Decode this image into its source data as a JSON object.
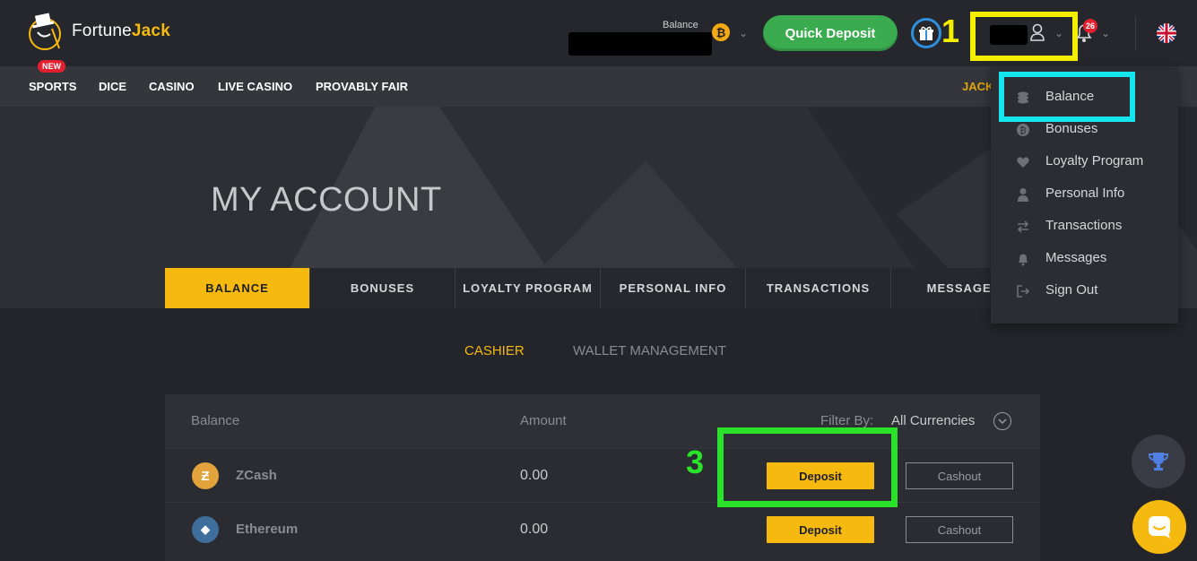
{
  "brand": {
    "name_part1": "Fortune",
    "name_part2": "Jack"
  },
  "header": {
    "balance_label": "Balance",
    "btc_symbol": "₿",
    "quick_deposit": "Quick Deposit",
    "notification_count": "26",
    "annotation_1": "1"
  },
  "nav": {
    "new_badge": "NEW",
    "items": [
      "SPORTS",
      "DICE",
      "CASINO",
      "LIVE CASINO",
      "PROVABLY FAIR"
    ],
    "jackpot_partial": "JACK"
  },
  "page": {
    "title": "MY ACCOUNT"
  },
  "tabs": [
    "BALANCE",
    "BONUSES",
    "LOYALTY PROGRAM",
    "PERSONAL INFO",
    "TRANSACTIONS",
    "MESSAGES"
  ],
  "subtabs": {
    "cashier": "CASHIER",
    "wallet": "WALLET MANAGEMENT"
  },
  "table": {
    "col_balance": "Balance",
    "col_amount": "Amount",
    "filter_label": "Filter By:",
    "filter_value": "All Currencies",
    "rows": [
      {
        "coin": "ZCash",
        "amount": "0.00",
        "deposit": "Deposit",
        "cashout": "Cashout",
        "color": "#e2a23c",
        "glyph": "Ƶ"
      },
      {
        "coin": "Ethereum",
        "amount": "0.00",
        "deposit": "Deposit",
        "cashout": "Cashout",
        "color": "#3f6e9c",
        "glyph": "◆"
      }
    ],
    "annotation_3": "3"
  },
  "dropdown": {
    "items": [
      {
        "label": "Balance",
        "icon": "coins-icon"
      },
      {
        "label": "Bonuses",
        "icon": "bitcoin-icon"
      },
      {
        "label": "Loyalty Program",
        "icon": "heart-icon"
      },
      {
        "label": "Personal Info",
        "icon": "person-icon"
      },
      {
        "label": "Transactions",
        "icon": "arrows-icon"
      },
      {
        "label": "Messages",
        "icon": "bell-icon"
      },
      {
        "label": "Sign Out",
        "icon": "sign-out-icon"
      }
    ]
  },
  "colors": {
    "accent": "#f6b90f",
    "green": "#3aac4f",
    "highlight_yellow": "#f4ee00",
    "highlight_cyan": "#15e6ee",
    "highlight_green": "#2be22b"
  }
}
